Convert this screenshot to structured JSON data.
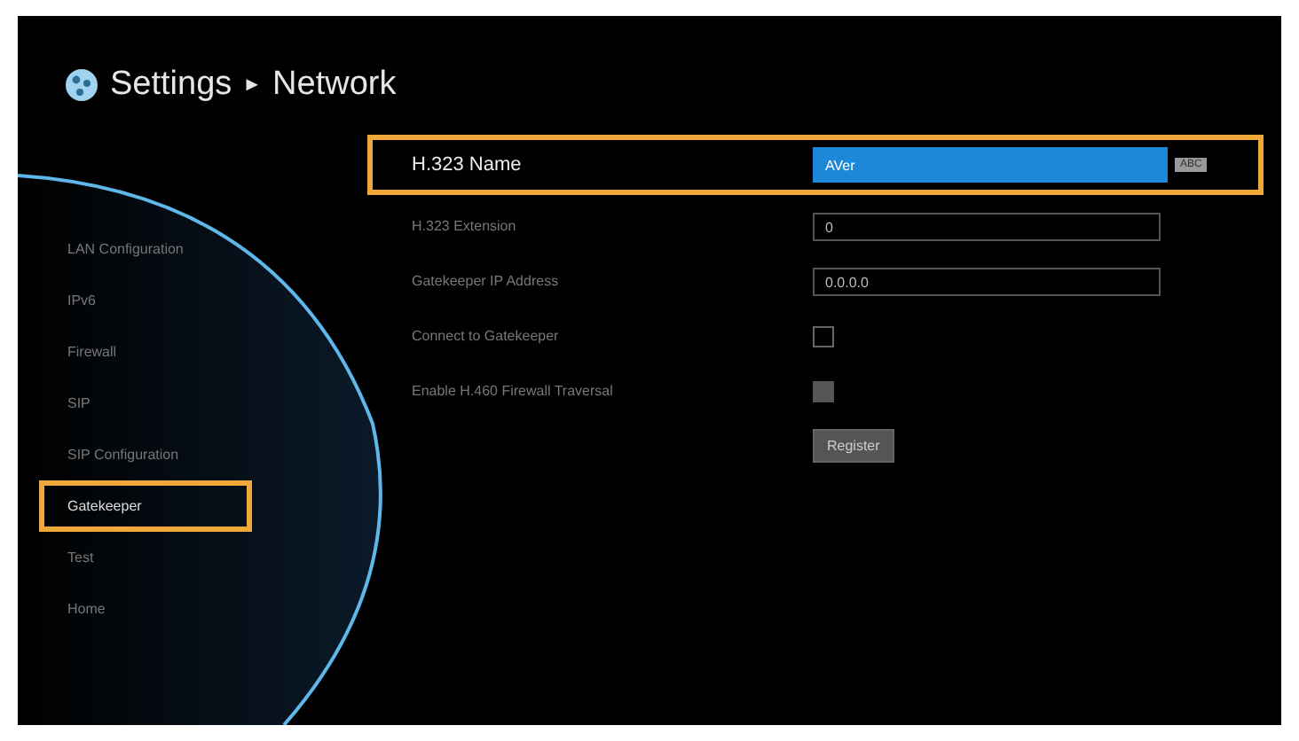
{
  "header": {
    "title": "Settings",
    "separator": "►",
    "section": "Network"
  },
  "sidebar": {
    "items": [
      {
        "label": "LAN Configuration",
        "selected": false
      },
      {
        "label": "IPv6",
        "selected": false
      },
      {
        "label": "Firewall",
        "selected": false
      },
      {
        "label": "SIP",
        "selected": false
      },
      {
        "label": "SIP Configuration",
        "selected": false
      },
      {
        "label": "Gatekeeper",
        "selected": true
      },
      {
        "label": "Test",
        "selected": false
      },
      {
        "label": "Home",
        "selected": false
      }
    ]
  },
  "form": {
    "rows": [
      {
        "kind": "text",
        "label": "H.323 Name",
        "value": "AVer",
        "selected": true,
        "badge": "ABC"
      },
      {
        "kind": "text",
        "label": "H.323 Extension",
        "value": "0",
        "selected": false
      },
      {
        "kind": "text",
        "label": "Gatekeeper IP Address",
        "value": "0.0.0.0",
        "selected": false
      },
      {
        "kind": "checkbox",
        "label": "Connect to Gatekeeper",
        "checked": false,
        "disabled": false,
        "selected": false
      },
      {
        "kind": "checkbox",
        "label": "Enable H.460 Firewall Traversal",
        "checked": false,
        "disabled": true,
        "selected": false
      }
    ],
    "button": "Register"
  }
}
